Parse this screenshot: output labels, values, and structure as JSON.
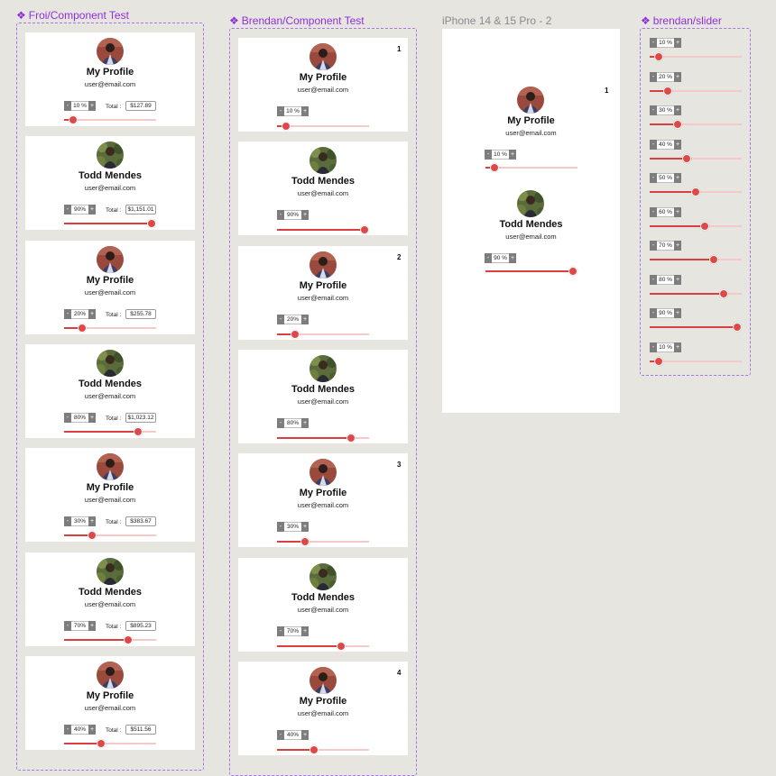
{
  "frames": {
    "froi": "Froi/Component Test",
    "brendan": "Brendan/Component Test",
    "iphone": "iPhone 14 & 15 Pro - 2",
    "slider": "brendan/slider"
  },
  "labels": {
    "total": "Total :",
    "minus": "-",
    "plus": "+"
  },
  "froi_cards": [
    {
      "name": "My Profile",
      "email": "user@email.com",
      "percent": "10 %",
      "total": "$127.89",
      "level": 0.1,
      "avatar": "dark"
    },
    {
      "name": "Todd Mendes",
      "email": "user@email.com",
      "percent": "90%",
      "total": "$1,151.01",
      "level": 0.95,
      "avatar": "plant"
    },
    {
      "name": "My Profile",
      "email": "user@email.com",
      "percent": "20%",
      "total": "$255.78",
      "level": 0.2,
      "avatar": "dark"
    },
    {
      "name": "Todd Mendes",
      "email": "user@email.com",
      "percent": "80%",
      "total": "$1,023.12",
      "level": 0.8,
      "avatar": "plant"
    },
    {
      "name": "My Profile",
      "email": "user@email.com",
      "percent": "30%",
      "total": "$383.67",
      "level": 0.3,
      "avatar": "dark"
    },
    {
      "name": "Todd Mendes",
      "email": "user@email.com",
      "percent": "70%",
      "total": "$895.23",
      "level": 0.7,
      "avatar": "plant"
    },
    {
      "name": "My Profile",
      "email": "user@email.com",
      "percent": "40%",
      "total": "$511.56",
      "level": 0.4,
      "avatar": "dark"
    }
  ],
  "brendan_cards": [
    {
      "name": "My Profile",
      "email": "user@email.com",
      "percent": "10 %",
      "level": 0.1,
      "avatar": "dark",
      "badge": "1"
    },
    {
      "name": "Todd Mendes",
      "email": "user@email.com",
      "percent": "90%",
      "level": 0.95,
      "avatar": "plant",
      "badge": ""
    },
    {
      "name": "My Profile",
      "email": "user@email.com",
      "percent": "20%",
      "level": 0.2,
      "avatar": "dark",
      "badge": "2"
    },
    {
      "name": "Todd Mendes",
      "email": "user@email.com",
      "percent": "80%",
      "level": 0.8,
      "avatar": "plant",
      "badge": ""
    },
    {
      "name": "My Profile",
      "email": "user@email.com",
      "percent": "30%",
      "level": 0.3,
      "avatar": "dark",
      "badge": "3"
    },
    {
      "name": "Todd Mendes",
      "email": "user@email.com",
      "percent": "70%",
      "level": 0.7,
      "avatar": "plant",
      "badge": ""
    },
    {
      "name": "My Profile",
      "email": "user@email.com",
      "percent": "40%",
      "level": 0.4,
      "avatar": "dark",
      "badge": "4"
    }
  ],
  "iphone": {
    "badge": "1",
    "users": [
      {
        "name": "My Profile",
        "email": "user@email.com",
        "percent": "10 %",
        "level": 0.1,
        "avatar": "dark"
      },
      {
        "name": "Todd Mendes",
        "email": "user@email.com",
        "percent": "90 %",
        "level": 0.95,
        "avatar": "plant"
      }
    ]
  },
  "slider_variants": [
    {
      "percent": "10 %",
      "level": 0.1
    },
    {
      "percent": "20 %",
      "level": 0.2
    },
    {
      "percent": "30 %",
      "level": 0.3
    },
    {
      "percent": "40 %",
      "level": 0.4
    },
    {
      "percent": "50 %",
      "level": 0.5
    },
    {
      "percent": "60 %",
      "level": 0.6
    },
    {
      "percent": "70 %",
      "level": 0.7
    },
    {
      "percent": "80 %",
      "level": 0.8
    },
    {
      "percent": "90 %",
      "level": 0.95
    },
    {
      "percent": "10 %",
      "level": 0.1
    }
  ],
  "colors": {
    "accent": "#e04848",
    "track": "#f6c9c9",
    "frame_label": "#8f2fdc"
  }
}
